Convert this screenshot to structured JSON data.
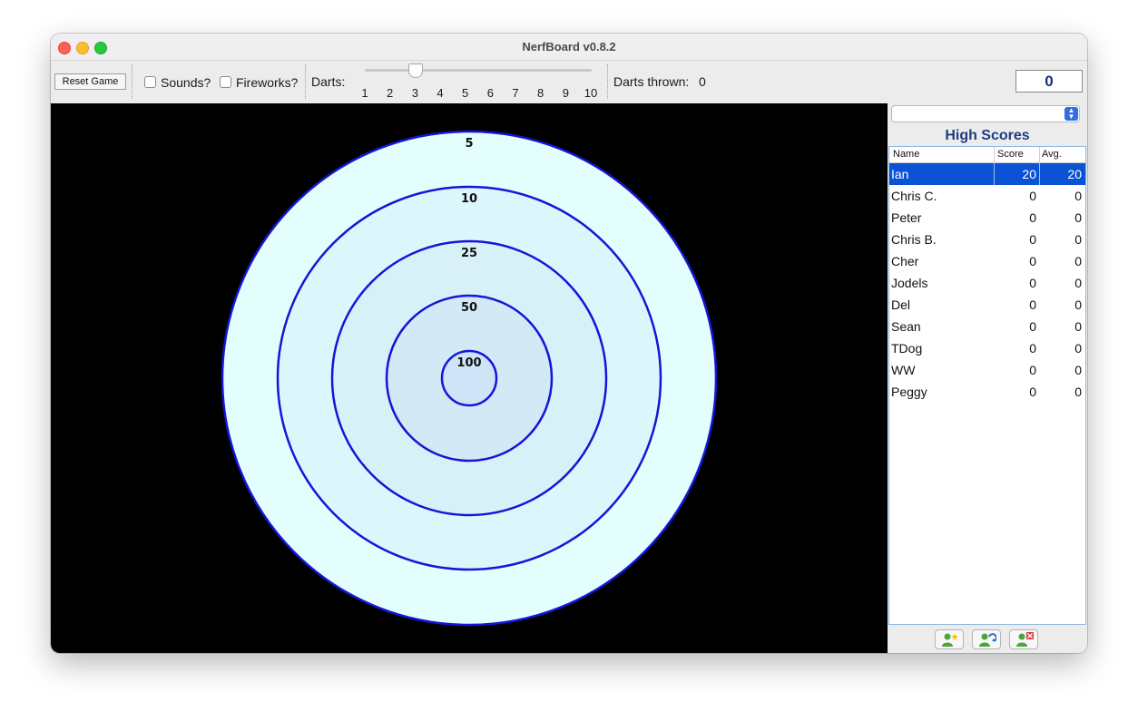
{
  "window": {
    "title": "NerfBoard v0.8.2"
  },
  "toolbar": {
    "reset_label": "Reset Game",
    "sounds_label": "Sounds?",
    "sounds_checked": false,
    "fireworks_label": "Fireworks?",
    "fireworks_checked": false,
    "darts_label": "Darts:",
    "darts_value": 3,
    "darts_ticks": [
      "1",
      "2",
      "3",
      "4",
      "5",
      "6",
      "7",
      "8",
      "9",
      "10"
    ],
    "thrown_label": "Darts thrown:",
    "thrown_value": "0",
    "score_display": "0"
  },
  "board": {
    "rings": [
      {
        "label": "5",
        "fill": "#e3fefd"
      },
      {
        "label": "10",
        "fill": "#dcf7fb"
      },
      {
        "label": "25",
        "fill": "#d8f1f8"
      },
      {
        "label": "50",
        "fill": "#d3eaf6"
      },
      {
        "label": "100",
        "fill": "#cfe5f7"
      }
    ],
    "ring_color": "#1515d8",
    "background": "#000000"
  },
  "high_scores": {
    "player_select_value": "",
    "title": "High Scores",
    "columns": {
      "name": "Name",
      "score": "Score",
      "avg": "Avg."
    },
    "rows": [
      {
        "name": "Ian",
        "score": "20",
        "avg": "20",
        "selected": true
      },
      {
        "name": "Chris C.",
        "score": "0",
        "avg": "0"
      },
      {
        "name": "Peter",
        "score": "0",
        "avg": "0"
      },
      {
        "name": "Chris B.",
        "score": "0",
        "avg": "0"
      },
      {
        "name": "Cher",
        "score": "0",
        "avg": "0"
      },
      {
        "name": "Jodels",
        "score": "0",
        "avg": "0"
      },
      {
        "name": "Del",
        "score": "0",
        "avg": "0"
      },
      {
        "name": "Sean",
        "score": "0",
        "avg": "0"
      },
      {
        "name": "TDog",
        "score": "0",
        "avg": "0"
      },
      {
        "name": "WW",
        "score": "0",
        "avg": "0"
      },
      {
        "name": "Peggy",
        "score": "0",
        "avg": "0"
      }
    ],
    "buttons": [
      {
        "icon": "add-user-icon"
      },
      {
        "icon": "refresh-user-icon"
      },
      {
        "icon": "remove-user-icon"
      }
    ]
  }
}
